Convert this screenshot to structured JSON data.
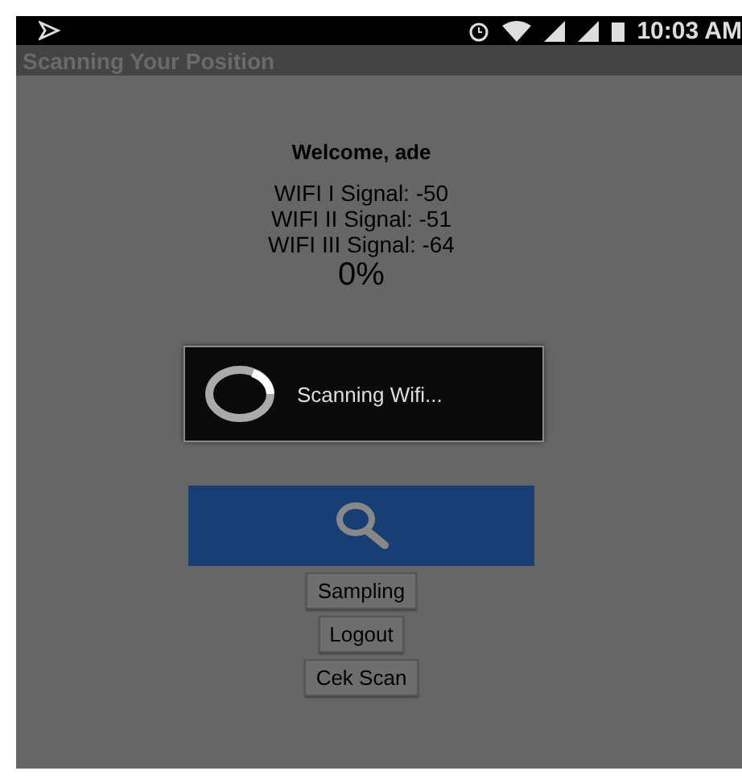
{
  "status_bar": {
    "time": "10:03 AM"
  },
  "app_bar": {
    "title": "Scanning Your Position"
  },
  "welcome": "Welcome, ade",
  "signals": [
    "WIFI I Signal: -50",
    "WIFI II Signal: -51",
    "WIFI III Signal: -64"
  ],
  "progress": "0%",
  "dialog": {
    "message": "Scanning Wifi..."
  },
  "buttons": [
    "Sampling",
    "Logout",
    "Cek Scan"
  ]
}
